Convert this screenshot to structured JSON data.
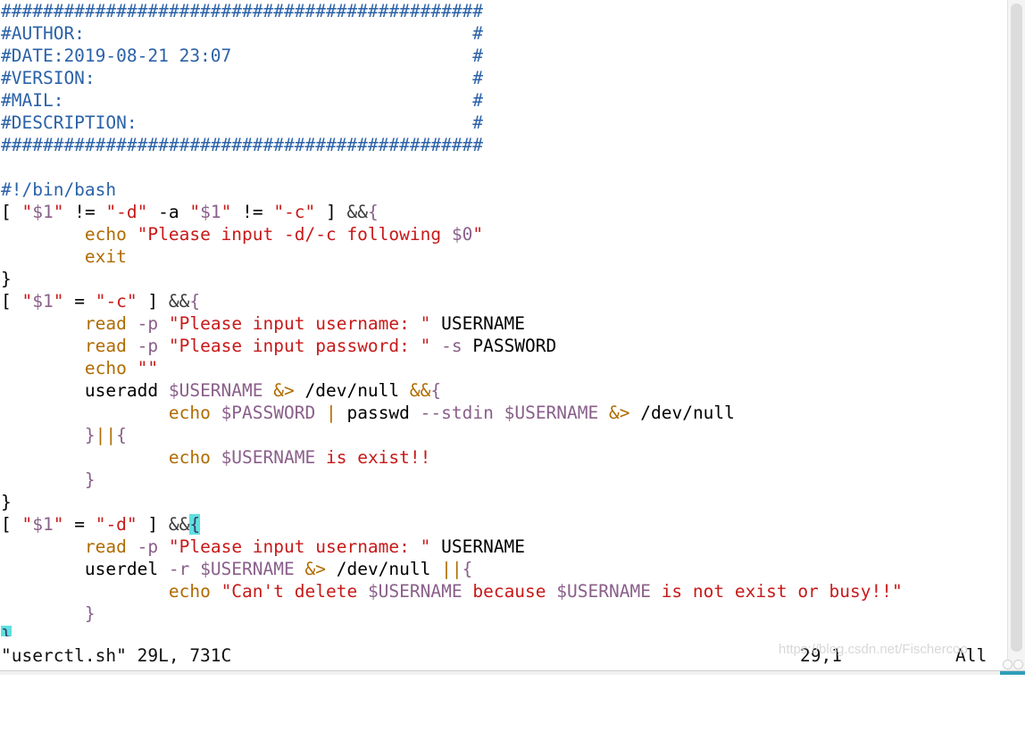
{
  "editor": {
    "app": "vim",
    "filename": "userctl.sh",
    "colors": {
      "comment": "#2b62a8",
      "string": "#c81919",
      "variable": "#8a5f8a",
      "keyword": "#b06b00",
      "operator": "#b06b00",
      "brace": "#8a5f8a",
      "plain": "#000000",
      "cursor_highlight": "#5ee0e0",
      "background": "#ffffff"
    },
    "lines": [
      {
        "n": 1,
        "tokens": [
          {
            "t": "##############################################",
            "c": "cm"
          }
        ]
      },
      {
        "n": 2,
        "tokens": [
          {
            "t": "#AUTHOR:                                     #",
            "c": "cm"
          }
        ]
      },
      {
        "n": 3,
        "tokens": [
          {
            "t": "#DATE:2019-08-21 23:07                       #",
            "c": "cm"
          }
        ]
      },
      {
        "n": 4,
        "tokens": [
          {
            "t": "#VERSION:                                    #",
            "c": "cm"
          }
        ]
      },
      {
        "n": 5,
        "tokens": [
          {
            "t": "#MAIL:                                       #",
            "c": "cm"
          }
        ]
      },
      {
        "n": 6,
        "tokens": [
          {
            "t": "#DESCRIPTION:                                #",
            "c": "cm"
          }
        ]
      },
      {
        "n": 7,
        "tokens": [
          {
            "t": "##############################################",
            "c": "cm"
          }
        ]
      },
      {
        "n": 8,
        "tokens": []
      },
      {
        "n": 9,
        "tokens": [
          {
            "t": "#!/bin/bash",
            "c": "cm"
          }
        ]
      },
      {
        "n": 10,
        "tokens": [
          {
            "t": "[ ",
            "c": "pl"
          },
          {
            "t": "\"",
            "c": "str"
          },
          {
            "t": "$1",
            "c": "var"
          },
          {
            "t": "\"",
            "c": "str"
          },
          {
            "t": " != ",
            "c": "pl"
          },
          {
            "t": "\"-d\"",
            "c": "str"
          },
          {
            "t": " -a ",
            "c": "pl"
          },
          {
            "t": "\"",
            "c": "str"
          },
          {
            "t": "$1",
            "c": "var"
          },
          {
            "t": "\"",
            "c": "str"
          },
          {
            "t": " != ",
            "c": "pl"
          },
          {
            "t": "\"-c\"",
            "c": "str"
          },
          {
            "t": " ] ",
            "c": "pl"
          },
          {
            "t": "&&",
            "c": "amp"
          },
          {
            "t": "{",
            "c": "br"
          }
        ]
      },
      {
        "n": 11,
        "tokens": [
          {
            "t": "        ",
            "c": "pl"
          },
          {
            "t": "echo",
            "c": "kw"
          },
          {
            "t": " ",
            "c": "pl"
          },
          {
            "t": "\"Please input -d/-c following ",
            "c": "str"
          },
          {
            "t": "$0",
            "c": "var"
          },
          {
            "t": "\"",
            "c": "str"
          }
        ]
      },
      {
        "n": 12,
        "tokens": [
          {
            "t": "        ",
            "c": "pl"
          },
          {
            "t": "exit",
            "c": "kw"
          }
        ]
      },
      {
        "n": 13,
        "tokens": [
          {
            "t": "}",
            "c": "pl"
          }
        ]
      },
      {
        "n": 14,
        "tokens": [
          {
            "t": "[ ",
            "c": "pl"
          },
          {
            "t": "\"",
            "c": "str"
          },
          {
            "t": "$1",
            "c": "var"
          },
          {
            "t": "\"",
            "c": "str"
          },
          {
            "t": " = ",
            "c": "pl"
          },
          {
            "t": "\"-c\"",
            "c": "str"
          },
          {
            "t": " ] ",
            "c": "pl"
          },
          {
            "t": "&&",
            "c": "amp"
          },
          {
            "t": "{",
            "c": "br"
          }
        ]
      },
      {
        "n": 15,
        "tokens": [
          {
            "t": "        ",
            "c": "pl"
          },
          {
            "t": "read",
            "c": "kw"
          },
          {
            "t": " ",
            "c": "pl"
          },
          {
            "t": "-p",
            "c": "opt"
          },
          {
            "t": " ",
            "c": "pl"
          },
          {
            "t": "\"Please input username: \"",
            "c": "str"
          },
          {
            "t": " USERNAME",
            "c": "pl"
          }
        ]
      },
      {
        "n": 16,
        "tokens": [
          {
            "t": "        ",
            "c": "pl"
          },
          {
            "t": "read",
            "c": "kw"
          },
          {
            "t": " ",
            "c": "pl"
          },
          {
            "t": "-p",
            "c": "opt"
          },
          {
            "t": " ",
            "c": "pl"
          },
          {
            "t": "\"Please input password: \"",
            "c": "str"
          },
          {
            "t": " ",
            "c": "pl"
          },
          {
            "t": "-s",
            "c": "opt"
          },
          {
            "t": " PASSWORD",
            "c": "pl"
          }
        ]
      },
      {
        "n": 17,
        "tokens": [
          {
            "t": "        ",
            "c": "pl"
          },
          {
            "t": "echo",
            "c": "kw"
          },
          {
            "t": " ",
            "c": "pl"
          },
          {
            "t": "\"\"",
            "c": "str"
          }
        ]
      },
      {
        "n": 18,
        "tokens": [
          {
            "t": "        useradd ",
            "c": "pl"
          },
          {
            "t": "$USERNAME",
            "c": "var"
          },
          {
            "t": " ",
            "c": "pl"
          },
          {
            "t": "&>",
            "c": "op"
          },
          {
            "t": " /dev/null ",
            "c": "pl"
          },
          {
            "t": "&&",
            "c": "op"
          },
          {
            "t": "{",
            "c": "br"
          }
        ]
      },
      {
        "n": 19,
        "tokens": [
          {
            "t": "                ",
            "c": "pl"
          },
          {
            "t": "echo",
            "c": "kw"
          },
          {
            "t": " ",
            "c": "pl"
          },
          {
            "t": "$PASSWORD",
            "c": "var"
          },
          {
            "t": " ",
            "c": "pl"
          },
          {
            "t": "|",
            "c": "op"
          },
          {
            "t": " passwd ",
            "c": "pl"
          },
          {
            "t": "--stdin",
            "c": "opt"
          },
          {
            "t": " ",
            "c": "pl"
          },
          {
            "t": "$USERNAME",
            "c": "var"
          },
          {
            "t": " ",
            "c": "pl"
          },
          {
            "t": "&>",
            "c": "op"
          },
          {
            "t": " /dev/null",
            "c": "pl"
          }
        ]
      },
      {
        "n": 20,
        "tokens": [
          {
            "t": "        ",
            "c": "pl"
          },
          {
            "t": "}",
            "c": "br"
          },
          {
            "t": "||",
            "c": "op"
          },
          {
            "t": "{",
            "c": "br"
          }
        ]
      },
      {
        "n": 21,
        "tokens": [
          {
            "t": "                ",
            "c": "pl"
          },
          {
            "t": "echo",
            "c": "kw"
          },
          {
            "t": " ",
            "c": "pl"
          },
          {
            "t": "$USERNAME",
            "c": "var"
          },
          {
            "t": " ",
            "c": "pl"
          },
          {
            "t": "is exist!!",
            "c": "bang"
          }
        ]
      },
      {
        "n": 22,
        "tokens": [
          {
            "t": "        ",
            "c": "pl"
          },
          {
            "t": "}",
            "c": "br"
          }
        ]
      },
      {
        "n": 23,
        "tokens": [
          {
            "t": "}",
            "c": "pl"
          }
        ]
      },
      {
        "n": 24,
        "tokens": [
          {
            "t": "[ ",
            "c": "pl"
          },
          {
            "t": "\"",
            "c": "str"
          },
          {
            "t": "$1",
            "c": "var"
          },
          {
            "t": "\"",
            "c": "str"
          },
          {
            "t": " = ",
            "c": "pl"
          },
          {
            "t": "\"-d\"",
            "c": "str"
          },
          {
            "t": " ] ",
            "c": "pl"
          },
          {
            "t": "&&",
            "c": "amp"
          },
          {
            "t": "{",
            "c": "cur"
          }
        ]
      },
      {
        "n": 25,
        "tokens": [
          {
            "t": "        ",
            "c": "pl"
          },
          {
            "t": "read",
            "c": "kw"
          },
          {
            "t": " ",
            "c": "pl"
          },
          {
            "t": "-p",
            "c": "opt"
          },
          {
            "t": " ",
            "c": "pl"
          },
          {
            "t": "\"Please input username: \"",
            "c": "str"
          },
          {
            "t": " USERNAME",
            "c": "pl"
          }
        ]
      },
      {
        "n": 26,
        "tokens": [
          {
            "t": "        userdel ",
            "c": "pl"
          },
          {
            "t": "-r",
            "c": "opt"
          },
          {
            "t": " ",
            "c": "pl"
          },
          {
            "t": "$USERNAME",
            "c": "var"
          },
          {
            "t": " ",
            "c": "pl"
          },
          {
            "t": "&>",
            "c": "op"
          },
          {
            "t": " /dev/null ",
            "c": "pl"
          },
          {
            "t": "||",
            "c": "op"
          },
          {
            "t": "{",
            "c": "br"
          }
        ]
      },
      {
        "n": 27,
        "tokens": [
          {
            "t": "                ",
            "c": "pl"
          },
          {
            "t": "echo",
            "c": "kw"
          },
          {
            "t": " ",
            "c": "pl"
          },
          {
            "t": "\"Can't delete ",
            "c": "str"
          },
          {
            "t": "$USERNAME",
            "c": "var"
          },
          {
            "t": " because ",
            "c": "str"
          },
          {
            "t": "$USERNAME",
            "c": "var"
          },
          {
            "t": " is not exist or busy!!\"",
            "c": "str"
          }
        ]
      },
      {
        "n": 28,
        "tokens": [
          {
            "t": "        ",
            "c": "pl"
          },
          {
            "t": "}",
            "c": "br"
          }
        ]
      },
      {
        "n": 29,
        "tokens": [
          {
            "t": "}",
            "c": "cur"
          }
        ]
      }
    ]
  },
  "statusline": {
    "file_info": "\"userctl.sh\" 29L, 731C",
    "cursor_position": "29,1",
    "scroll_position": "All"
  },
  "watermark": {
    "text": "https://blog.csdn.net/Fischercoo"
  },
  "scrollbar": {
    "orientation": "vertical"
  }
}
